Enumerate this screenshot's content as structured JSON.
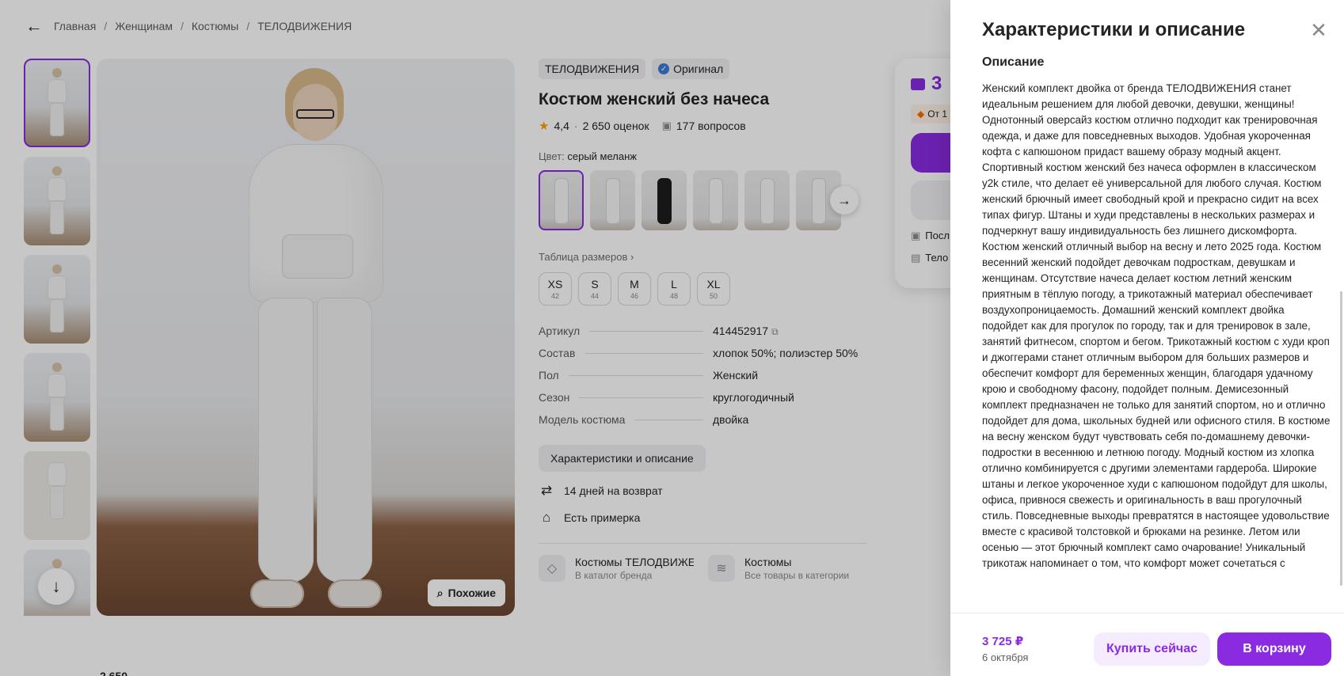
{
  "breadcrumb": {
    "items": [
      "Главная",
      "Женщинам",
      "Костюмы",
      "ТЕЛОДВИЖЕНИЯ"
    ]
  },
  "gallery": {
    "similar_label": "Похожие"
  },
  "product": {
    "brand": "ТЕЛОДВИЖЕНИЯ",
    "original_label": "Оригинал",
    "title": "Костюм женский без начеса",
    "rating": "4,4",
    "ratings_count": "2 650 оценок",
    "questions_count": "177 вопросов",
    "color_key": "Цвет:",
    "color_value": "серый меланж",
    "size_table_label": "Таблица размеров",
    "sizes": [
      {
        "name": "XS",
        "ru": "42"
      },
      {
        "name": "S",
        "ru": "44"
      },
      {
        "name": "M",
        "ru": "46"
      },
      {
        "name": "L",
        "ru": "48"
      },
      {
        "name": "XL",
        "ru": "50"
      }
    ],
    "specs": [
      {
        "key": "Артикул",
        "value": "414452917"
      },
      {
        "key": "Состав",
        "value": "хлопок 50%; полиэстер 50%"
      },
      {
        "key": "Пол",
        "value": "Женский"
      },
      {
        "key": "Сезон",
        "value": "круглогодичный"
      },
      {
        "key": "Модель костюма",
        "value": "двойка"
      }
    ],
    "characteristics_button": "Характеристики и описание",
    "features": [
      {
        "icon": "return-arrows-icon",
        "label": "14 дней на возврат"
      },
      {
        "icon": "hanger-icon",
        "label": "Есть примерка"
      }
    ],
    "brand_links": [
      {
        "icon": "tag-icon",
        "title": "Костюмы ТЕЛОДВИЖЕНИЯ",
        "subtitle": "В каталог бренда"
      },
      {
        "icon": "layers-icon",
        "title": "Костюмы",
        "subtitle": "Все товары в категории"
      }
    ]
  },
  "price_card": {
    "price_partial": "3",
    "chip_partial": "От 1",
    "row1_partial": "Посл",
    "row2_partial": "Тело"
  },
  "bottom_peek": "2 650",
  "drawer": {
    "title": "Характеристики и описание",
    "description_heading": "Описание",
    "description": "Женский комплект двойка от бренда ТЕЛОДВИЖЕНИЯ станет идеальным решением для любой девочки, девушки, женщины! Однотонный оверсайз костюм отлично подходит как тренировочная одежда, и даже для повседневных выходов. Удобная укороченная кофта с капюшоном придаст вашему образу модный акцент. Спортивный костюм женский без начеса оформлен в классическом y2k стиле, что делает её универсальной для любого случая. Костюм женский брючный имеет свободный крой и прекрасно сидит на всех типах фигур. Штаны и худи представлены в нескольких размерах и подчеркнут вашу индивидуальность без лишнего дискомфорта. Костюм женский отличный выбор на весну и лето 2025 года. Костюм весенний женский подойдет девочкам подросткам, девушкам и женщинам. Отсутствие начеса делает костюм летний женским приятным в тёплую погоду, а трикотажный материал обеспечивает воздухопроницаемость. Домашний женский комплект двойка подойдет как для прогулок по городу, так и для тренировок в зале, занятий фитнесом, спортом и бегом. Трикотажный костюм с худи кроп и джоггерами станет отличным выбором для больших размеров и обеспечит комфорт для беременных женщин, благодаря удачному крою и свободному фасону, подойдет полным. Демисезонный комплект предназначен не только для занятий спортом, но и отлично подойдет для дома, школьных будней или офисного стиля. В костюме на весну женском будут чувствовать себя по-домашнему девочки-подростки в весеннюю и летнюю погоду. Модный костюм из хлопка отлично комбинируется с другими элементами гардероба. Широкие штаны и легкое укороченное худи с капюшоном подойдут для школы, офиса, привнося свежесть и оригинальность в ваш прогулочный стиль. Повседневные выходы превратятся в настоящее удовольствие вместе с красивой толстовкой и брюками на резинке. Летом или осенью — этот брючный комплект само очарование! Уникальный трикотаж напоминает о том, что комфорт может сочетаться с",
    "footer_price": "3 725 ₽",
    "footer_date": "6 октября",
    "buy_now": "Купить сейчас",
    "add_to_cart": "В корзину"
  },
  "colors": {
    "accent": "#8a2be2",
    "accent_light": "#f4ecfe",
    "rating_star": "#ff9f00"
  }
}
